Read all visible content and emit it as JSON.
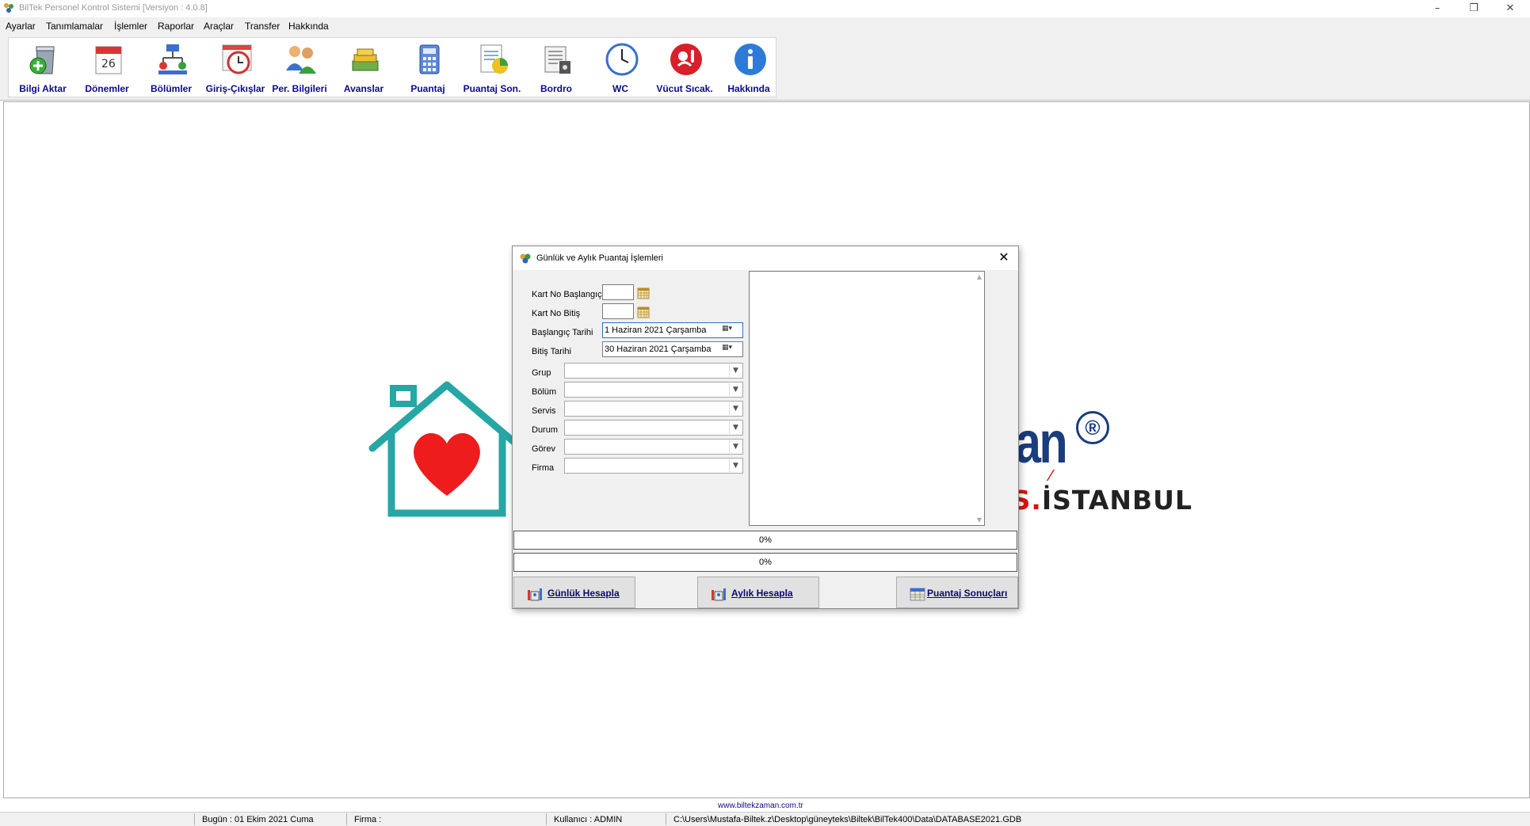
{
  "window": {
    "title": "BilTek Personel Kontrol Sistemi [Versiyon : 4.0.8]",
    "minimize": "–",
    "restore": "❐",
    "close": "✕"
  },
  "menu": [
    "Ayarlar",
    "Tanımlamalar",
    "İşlemler",
    "Raporlar",
    "Araçlar",
    "Transfer",
    "Hakkında"
  ],
  "toolbar": [
    {
      "label": "Bilgi Aktar",
      "icon": "database-import-icon"
    },
    {
      "label": "Dönemler",
      "icon": "calendar-icon"
    },
    {
      "label": "Bölümler",
      "icon": "org-chart-icon"
    },
    {
      "label": "Giriş-Çıkışlar",
      "icon": "clock-calendar-icon"
    },
    {
      "label": "Per. Bilgileri",
      "icon": "people-icon"
    },
    {
      "label": "Avanslar",
      "icon": "money-stack-icon"
    },
    {
      "label": "Puantaj",
      "icon": "calculator-icon"
    },
    {
      "label": "Puantaj Son.",
      "icon": "report-chart-icon"
    },
    {
      "label": "Bordro",
      "icon": "payroll-document-icon"
    },
    {
      "label": "WC",
      "icon": "wall-clock-icon"
    },
    {
      "label": "Vücut Sıcak.",
      "icon": "body-temperature-icon"
    },
    {
      "label": "Hakkında",
      "icon": "info-icon"
    }
  ],
  "logo": {
    "text_partial": "an",
    "reg": "®",
    "city_red": "KS.",
    "city_dark": "İSTANBUL"
  },
  "dialog": {
    "title": "Günlük ve Aylık Puantaj İşlemleri",
    "close": "✕",
    "fields": {
      "kart_no_baslangic": "Kart No Başlangıç",
      "kart_no_bitis": "Kart No Bitiş",
      "baslangic_tarihi": "Başlangıç Tarihi",
      "baslangic_tarihi_value": "1 Haziran 2021 Çarşamba",
      "bitis_tarihi": "Bitiş Tarihi",
      "bitis_tarihi_value": "30 Haziran 2021 Çarşamba",
      "grup": "Grup",
      "bolum": "Bölüm",
      "servis": "Servis",
      "durum": "Durum",
      "gorev": "Görev",
      "firma": "Firma"
    },
    "progress1": "0%",
    "progress2": "0%",
    "buttons": {
      "gunluk": "Günlük Hesapla",
      "aylik": "Aylık Hesapla",
      "sonuclar": "Puantaj Sonuçları"
    }
  },
  "footer": {
    "website": "www.biltekzaman.com.tr",
    "bugun": "Bugün : 01 Ekim 2021 Cuma",
    "firma": "Firma :",
    "kullanici": "Kullanıcı : ADMIN",
    "path": "C:\\Users\\Mustafa-Biltek.z\\Desktop\\güneyteks\\Biltek\\BilTek400\\Data\\DATABASE2021.GDB"
  },
  "colors": {
    "toolbar_label": "#0a0a8a",
    "logo_teal": "#26a6a4",
    "heart": "#ee1c1c",
    "logo_blue": "#1a3d7c"
  }
}
